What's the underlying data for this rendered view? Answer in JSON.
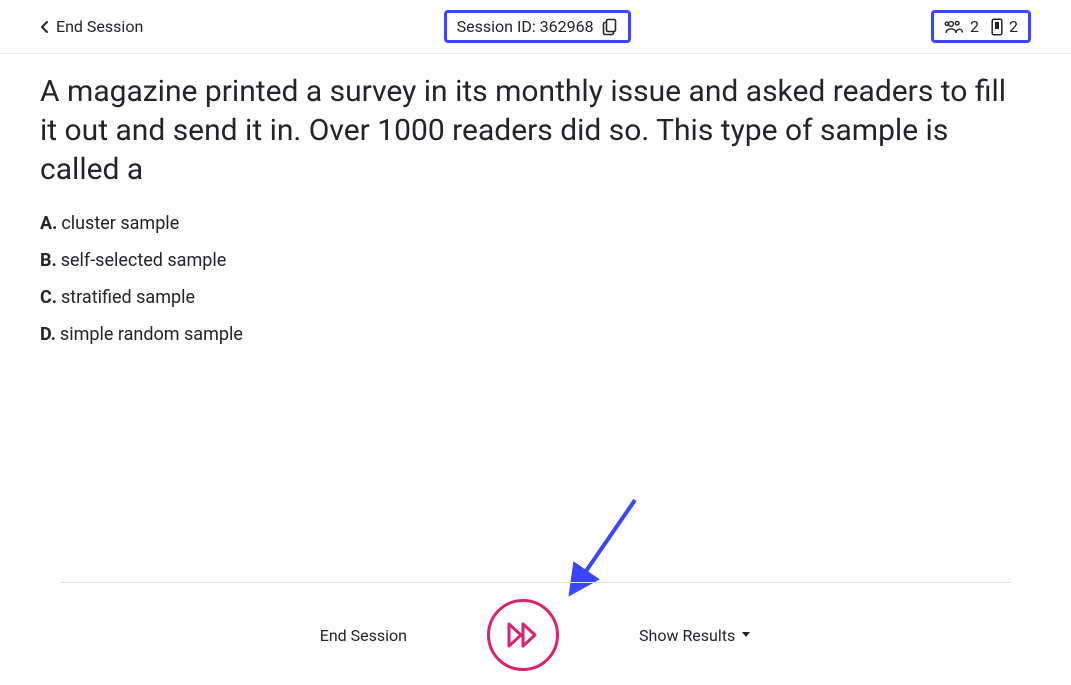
{
  "header": {
    "end_session_label": "End Session",
    "session_id_label": "Session ID: 362968",
    "participants_count": "2",
    "devices_count": "2"
  },
  "question": {
    "prompt": "A magazine printed a survey in its monthly issue and asked readers to fill it out and send it in. Over 1000 readers did so. This type of sample is called a",
    "options": [
      {
        "letter": "A.",
        "text": "cluster sample"
      },
      {
        "letter": "B.",
        "text": "self-selected sample"
      },
      {
        "letter": "C.",
        "text": "stratified sample"
      },
      {
        "letter": "D.",
        "text": "simple random sample"
      }
    ]
  },
  "footer": {
    "end_session_label": "End Session",
    "show_results_label": "Show Results"
  },
  "colors": {
    "highlight_box_border": "#3a46ff",
    "next_button_pink": "#d6246e"
  }
}
